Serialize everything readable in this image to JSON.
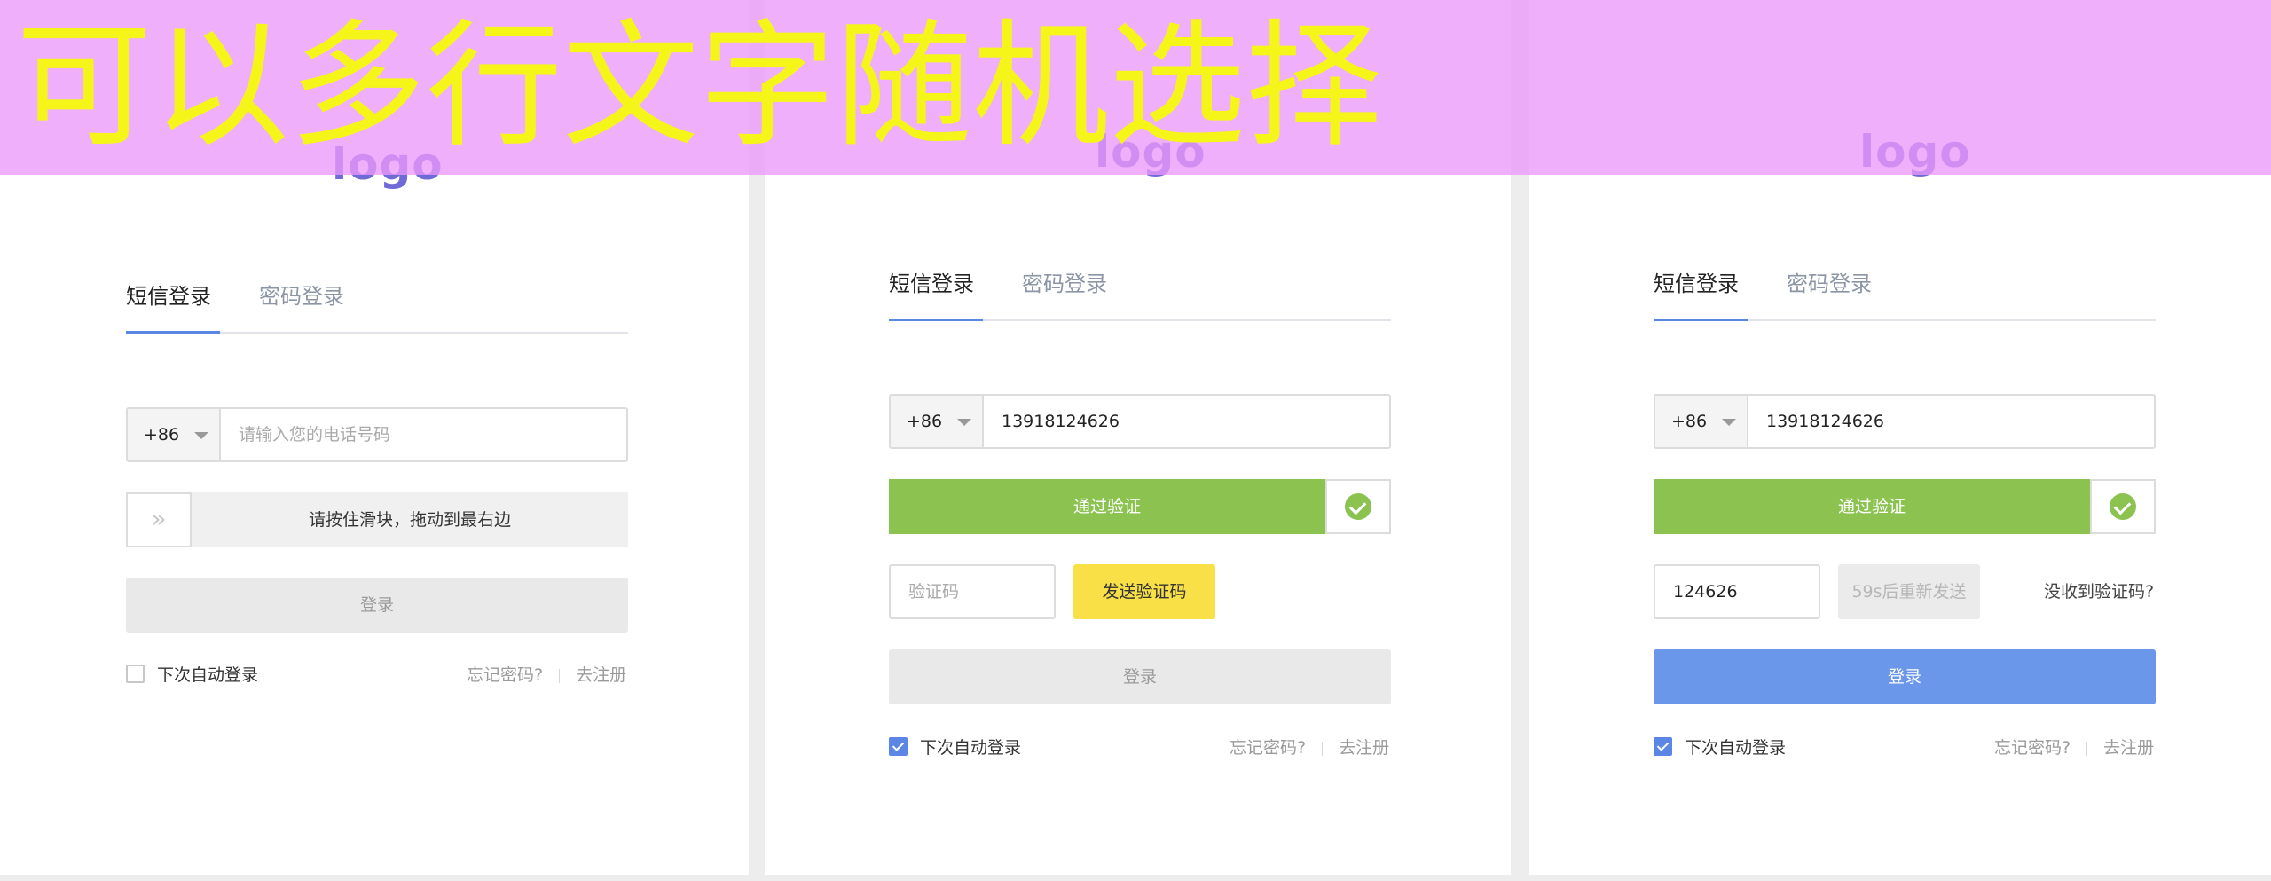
{
  "banner": {
    "text": "可以多行文字随机选择"
  },
  "common": {
    "logo": "logo",
    "tab_sms": "短信登录",
    "tab_password": "密码登录",
    "country_code": "+86",
    "login_label": "登录",
    "auto_login": "下次自动登录",
    "forgot": "忘记密码?",
    "register": "去注册"
  },
  "panel1": {
    "phone_placeholder": "请输入您的电话号码",
    "slider_text": "请按住滑块，拖动到最右边",
    "slider_handle": "»",
    "auto_login_checked": false
  },
  "panel2": {
    "phone_value": "13918124626",
    "verified_text": "通过验证",
    "code_placeholder": "验证码",
    "send_code": "发送验证码",
    "auto_login_checked": true
  },
  "panel3": {
    "phone_value": "13918124626",
    "verified_text": "通过验证",
    "code_value": "124626",
    "resend": "59s后重新发送",
    "no_code": "没收到验证码?",
    "auto_login_checked": true
  },
  "colors": {
    "accent": "#5b86e5",
    "verified_green": "#8bc250",
    "send_yellow": "#f8e046",
    "login_enabled": "#6b97ea",
    "banner_bg": "#ec98fa",
    "banner_text": "#f6f51a"
  },
  "icons": {
    "slider_handle": "double-chevron-right-icon",
    "verified": "check-circle-icon",
    "dropdown": "caret-down-icon",
    "checkbox": "checkmark-icon"
  }
}
